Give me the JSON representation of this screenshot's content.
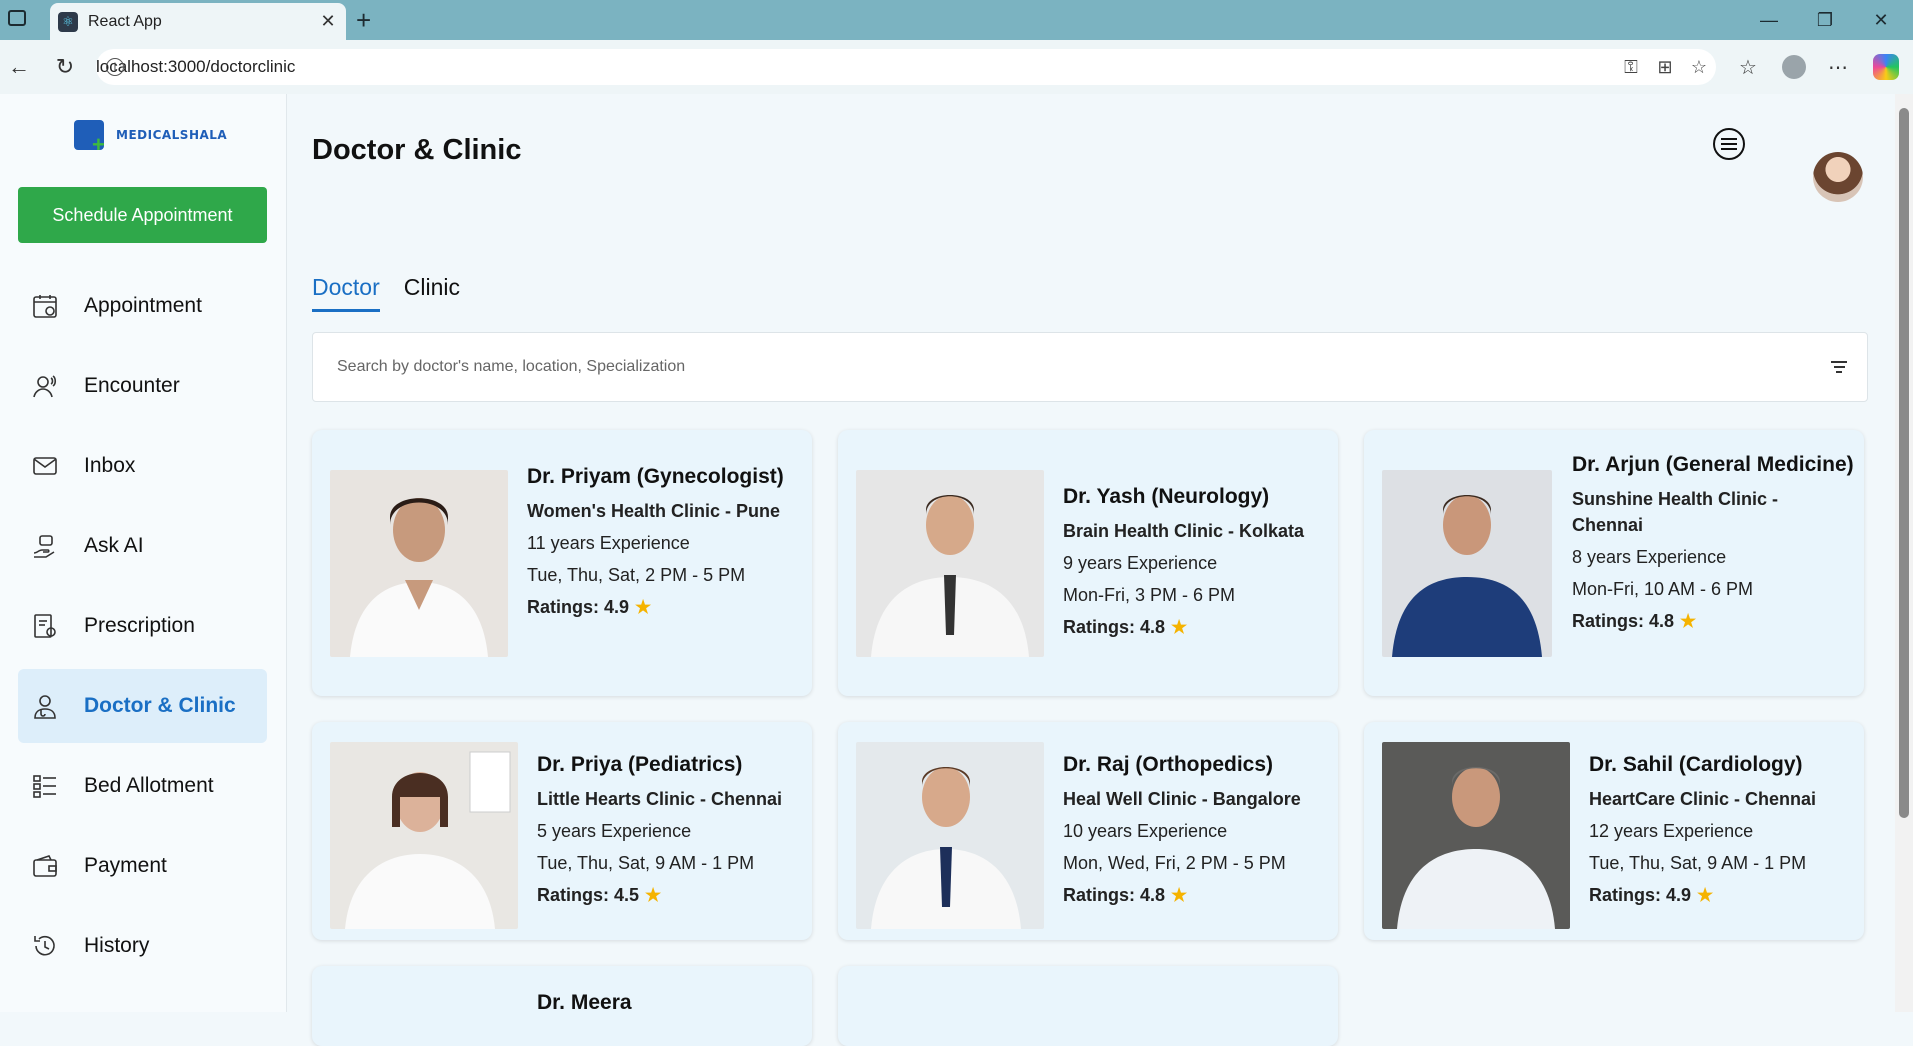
{
  "browser": {
    "tab_title": "React App",
    "url": "localhost:3000/doctorclinic"
  },
  "sidebar": {
    "logo_text": "MEDICALSHALA",
    "schedule_button": "Schedule Appointment",
    "items": [
      {
        "label": "Appointment",
        "icon": "calendar-icon"
      },
      {
        "label": "Encounter",
        "icon": "user-voice-icon"
      },
      {
        "label": "Inbox",
        "icon": "mail-icon"
      },
      {
        "label": "Ask AI",
        "icon": "ai-hand-icon"
      },
      {
        "label": "Prescription",
        "icon": "prescription-icon"
      },
      {
        "label": "Doctor & Clinic",
        "icon": "doctor-icon",
        "active": true
      },
      {
        "label": "Bed Allotment",
        "icon": "bed-list-icon"
      },
      {
        "label": "Payment",
        "icon": "wallet-icon"
      },
      {
        "label": "History",
        "icon": "history-icon"
      }
    ]
  },
  "main": {
    "title": "Doctor & Clinic",
    "tabs": [
      {
        "label": "Doctor",
        "active": true
      },
      {
        "label": "Clinic",
        "active": false
      }
    ],
    "search_placeholder": "Search by doctor's name, location, Specialization",
    "doctors": [
      {
        "name": "Dr. Priyam (Gynecologist)",
        "clinic": "Women's Health Clinic - Pune",
        "experience": "11 years Experience",
        "timing": "Tue, Thu, Sat, 2 PM - 5 PM",
        "rating": "Ratings: 4.9"
      },
      {
        "name": "Dr. Yash (Neurology)",
        "clinic": "Brain Health Clinic - Kolkata",
        "experience": "9 years Experience",
        "timing": "Mon-Fri, 3 PM - 6 PM",
        "rating": "Ratings: 4.8"
      },
      {
        "name": "Dr. Arjun (General Medicine)",
        "clinic": "Sunshine Health Clinic - Chennai",
        "experience": "8 years Experience",
        "timing": "Mon-Fri, 10 AM - 6 PM",
        "rating": "Ratings: 4.8"
      },
      {
        "name": "Dr. Priya (Pediatrics)",
        "clinic": "Little Hearts Clinic - Chennai",
        "experience": "5 years Experience",
        "timing": "Tue, Thu, Sat, 9 AM - 1 PM",
        "rating": "Ratings: 4.5"
      },
      {
        "name": "Dr. Raj (Orthopedics)",
        "clinic": "Heal Well Clinic - Bangalore",
        "experience": "10 years Experience",
        "timing": "Mon, Wed, Fri, 2 PM - 5 PM",
        "rating": "Ratings: 4.8"
      },
      {
        "name": "Dr. Sahil (Cardiology)",
        "clinic": "HeartCare Clinic - Chennai",
        "experience": "12 years Experience",
        "timing": "Tue, Thu, Sat, 9 AM - 1 PM",
        "rating": "Ratings: 4.9"
      },
      {
        "name": "Dr. Meera"
      }
    ]
  },
  "colors": {
    "accent": "#1a6fc4",
    "button_green": "#2fa84a",
    "card_bg": "#e9f5fc",
    "star": "#f5b300"
  }
}
